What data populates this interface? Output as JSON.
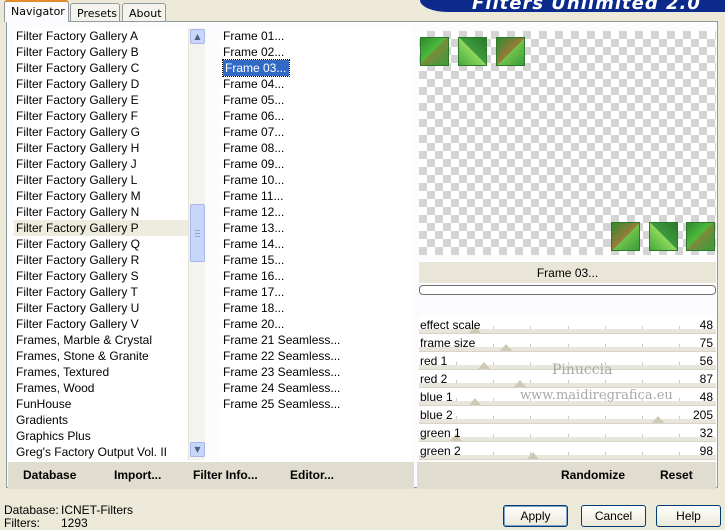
{
  "title": "Filters Unlimited 2.0",
  "tabs": [
    "Navigator",
    "Presets",
    "About"
  ],
  "categories": [
    "Filter Factory Gallery A",
    "Filter Factory Gallery B",
    "Filter Factory Gallery C",
    "Filter Factory Gallery D",
    "Filter Factory Gallery E",
    "Filter Factory Gallery F",
    "Filter Factory Gallery G",
    "Filter Factory Gallery H",
    "Filter Factory Gallery J",
    "Filter Factory Gallery L",
    "Filter Factory Gallery M",
    "Filter Factory Gallery N",
    "Filter Factory Gallery P",
    "Filter Factory Gallery Q",
    "Filter Factory Gallery R",
    "Filter Factory Gallery S",
    "Filter Factory Gallery T",
    "Filter Factory Gallery U",
    "Filter Factory Gallery V",
    "Frames, Marble & Crystal",
    "Frames, Stone & Granite",
    "Frames, Textured",
    "Frames, Wood",
    "FunHouse",
    "Gradients",
    "Graphics Plus",
    "Greg's Factory Output Vol. II"
  ],
  "selected_category": "Filter Factory Gallery P",
  "filters": [
    "Frame 01...",
    "Frame 02...",
    "Frame 03...",
    "Frame 04...",
    "Frame 05...",
    "Frame 06...",
    "Frame 07...",
    "Frame 08...",
    "Frame 09...",
    "Frame 10...",
    "Frame 11...",
    "Frame 12...",
    "Frame 13...",
    "Frame 14...",
    "Frame 15...",
    "Frame 16...",
    "Frame 17...",
    "Frame 18...",
    "Frame 20...",
    "Frame 21 Seamless...",
    "Frame 22 Seamless...",
    "Frame 23 Seamless...",
    "Frame 24 Seamless...",
    "Frame 25 Seamless..."
  ],
  "selected_filter": "Frame 03...",
  "bottom_buttons": {
    "database": "Database",
    "import": "Import...",
    "filter_info": "Filter Info...",
    "editor": "Editor...",
    "randomize": "Randomize",
    "reset": "Reset"
  },
  "preview_label": "Frame 03...",
  "sliders": [
    {
      "label": "effect scale",
      "value": 48
    },
    {
      "label": "frame size",
      "value": 75
    },
    {
      "label": "red 1",
      "value": 56
    },
    {
      "label": "red 2",
      "value": 87
    },
    {
      "label": "blue 1",
      "value": 48
    },
    {
      "label": "blue 2",
      "value": 205
    },
    {
      "label": "green 1",
      "value": 32
    },
    {
      "label": "green 2",
      "value": 98
    }
  ],
  "watermark": {
    "line1": "Pinuccia",
    "line2": "www.maidiregrafica.eu"
  },
  "status": {
    "database_label": "Database:",
    "database_value": "ICNET-Filters",
    "filters_label": "Filters:",
    "filters_value": "1293"
  },
  "dialog_buttons": {
    "apply": "Apply",
    "cancel": "Cancel",
    "help": "Help"
  },
  "icons": {
    "scroll_up": "chevron-up-icon",
    "scroll_down": "chevron-down-icon"
  }
}
